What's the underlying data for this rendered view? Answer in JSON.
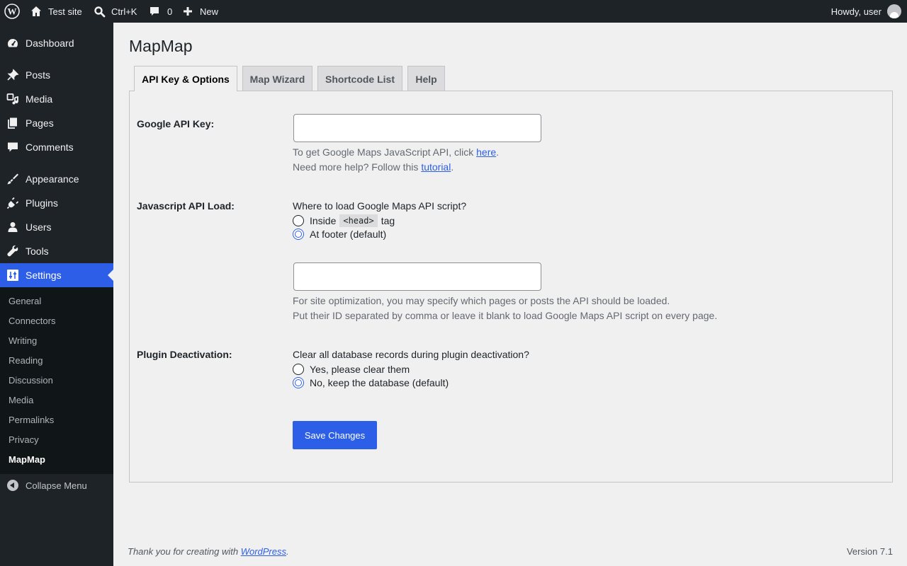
{
  "adminbar": {
    "site_name": "Test site",
    "search_shortcut": "Ctrl+K",
    "comments_count": "0",
    "new_label": "New",
    "howdy": "Howdy, user"
  },
  "sidebar": {
    "items": [
      {
        "label": "Dashboard",
        "icon": "dashboard-icon"
      },
      {
        "label": "Posts",
        "icon": "pin-icon"
      },
      {
        "label": "Media",
        "icon": "media-icon"
      },
      {
        "label": "Pages",
        "icon": "pages-icon"
      },
      {
        "label": "Comments",
        "icon": "comment-icon"
      },
      {
        "label": "Appearance",
        "icon": "brush-icon"
      },
      {
        "label": "Plugins",
        "icon": "plug-icon"
      },
      {
        "label": "Users",
        "icon": "user-icon"
      },
      {
        "label": "Tools",
        "icon": "wrench-icon"
      },
      {
        "label": "Settings",
        "icon": "settings-icon"
      }
    ],
    "submenu": [
      "General",
      "Connectors",
      "Writing",
      "Reading",
      "Discussion",
      "Media",
      "Permalinks",
      "Privacy",
      "MapMap"
    ],
    "collapse_label": "Collapse Menu"
  },
  "page": {
    "title": "MapMap",
    "tabs": [
      "API Key & Options",
      "Map Wizard",
      "Shortcode List",
      "Help"
    ],
    "api_key": {
      "label": "Google API Key:",
      "value": "",
      "desc1_prefix": "To get Google Maps JavaScript API, click ",
      "desc1_link": "here",
      "desc1_suffix": ".",
      "desc2_prefix": "Need more help? Follow this ",
      "desc2_link": "tutorial",
      "desc2_suffix": "."
    },
    "js_load": {
      "label": "Javascript API Load:",
      "question": "Where to load Google Maps API script?",
      "opt1_prefix": "Inside",
      "opt1_code": "<head>",
      "opt1_suffix": "tag",
      "opt2": "At footer (default)",
      "selected": "At footer (default)",
      "pages_value": "",
      "desc1": "For site optimization, you may specify which pages or posts the API should be loaded.",
      "desc2": "Put their ID separated by comma or leave it blank to load Google Maps API script on every page."
    },
    "deactivation": {
      "label": "Plugin Deactivation:",
      "question": "Clear all database records during plugin deactivation?",
      "opt1": "Yes, please clear them",
      "opt2": "No, keep the database (default)",
      "selected": "No, keep the database (default)"
    },
    "save_label": "Save Changes"
  },
  "footer": {
    "left_prefix": "Thank you for creating with ",
    "left_link": "WordPress",
    "left_suffix": ".",
    "version": "Version 7.1"
  },
  "colors": {
    "accent": "#2c5ee8",
    "sidebar_bg": "#1d2327",
    "submenu_bg": "#101517",
    "page_bg": "#f0f0f1"
  }
}
